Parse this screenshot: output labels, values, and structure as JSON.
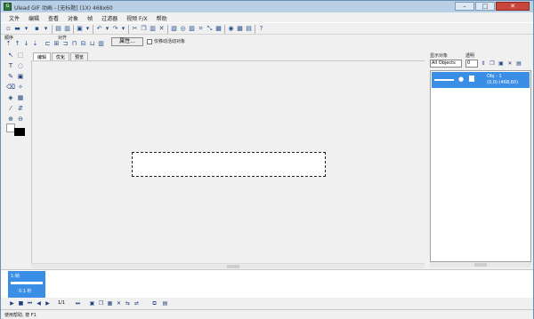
{
  "window": {
    "title": "Ulead GIF 动画 - [无标题] (1X) 468x60",
    "controls": {
      "minimize": "–",
      "maximize": "□",
      "close": "✕"
    }
  },
  "menu": [
    "文件",
    "编辑",
    "查看",
    "对象",
    "帧",
    "过滤器",
    "视频 F/X",
    "帮助"
  ],
  "toolbar2": {
    "order_label": "顺序",
    "align_label": "对齐",
    "properties_button": "属性...",
    "move_only_label": "仅移动活动对象"
  },
  "tabs": [
    "编辑",
    "优化",
    "预览"
  ],
  "object_panel": {
    "objects_label": "显示对象",
    "opacity_label": "透明",
    "filter_value": "All Objects",
    "opacity_value": "0",
    "item": {
      "name": "Obj - 1",
      "rect": "(0,0)-(468,60)"
    }
  },
  "frames": [
    {
      "label": "1:帧",
      "time": "0.1 秒"
    }
  ],
  "frame_counter": "1/1",
  "status": "使用帮助, 按 F1",
  "colors": {
    "title_bar": "#b9cfe6",
    "selection": "#3a8ee6",
    "close_button": "#c9473a",
    "foreground_color": "#000000",
    "background_color": "#ffffff"
  }
}
